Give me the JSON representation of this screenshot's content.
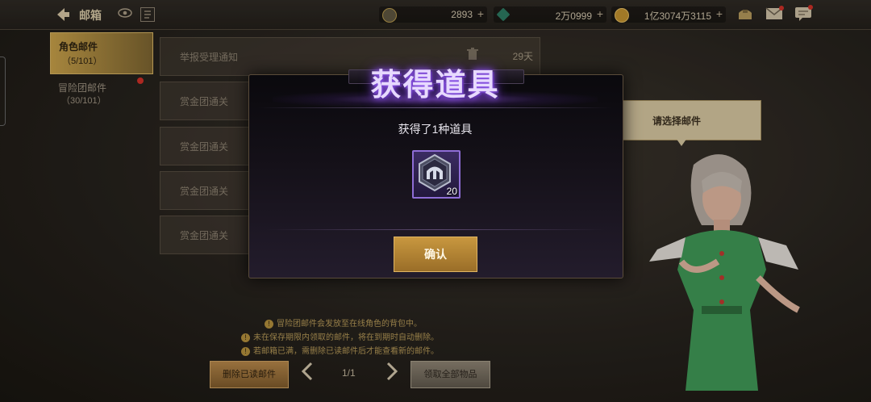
{
  "header": {
    "back_icon": "back-arrow-icon",
    "title": "邮箱",
    "eye_icon": "eye-icon",
    "book_icon": "book-icon",
    "currencies": [
      {
        "icon": "coin-icon",
        "value": "2893",
        "color": "#c7a24a"
      },
      {
        "icon": "gem-icon",
        "value": "2万0999",
        "color": "#3fb38d"
      },
      {
        "icon": "gold-coin-icon",
        "value": "1亿3074万3115",
        "color": "#d2a23a"
      }
    ],
    "plus_label": "+",
    "right_icons": [
      "bag-icon",
      "mail-icon",
      "chat-icon"
    ]
  },
  "sidebar": {
    "tabs": [
      {
        "label": "角色邮件",
        "count": "（5/101）",
        "active": true
      },
      {
        "label": "冒险团邮件",
        "count": "（30/101）",
        "active": false,
        "badge": true
      }
    ]
  },
  "mail_list": {
    "items": [
      {
        "subject": "举报受理通知",
        "days": "29天"
      },
      {
        "subject": "赏金团通关"
      },
      {
        "subject": "赏金团通关"
      },
      {
        "subject": "赏金团通关"
      },
      {
        "subject": "赏金团通关"
      }
    ]
  },
  "npc": {
    "bubble_text": "请选择邮件"
  },
  "notes": [
    "冒险团邮件会发放至在线角色的背包中。",
    "未在保存期限内领取的邮件，将在到期时自动删除。",
    "若邮箱已满，需删除已读邮件后才能查看新的邮件。"
  ],
  "footer": {
    "delete_read_label": "删除已读邮件",
    "page_text": "1/1",
    "claim_all_label": "领取全部物品"
  },
  "modal": {
    "title": "获得道具",
    "subtitle": "获得了1种道具",
    "item": {
      "icon": "helmet-icon",
      "quantity": "20"
    },
    "confirm_label": "确认"
  }
}
